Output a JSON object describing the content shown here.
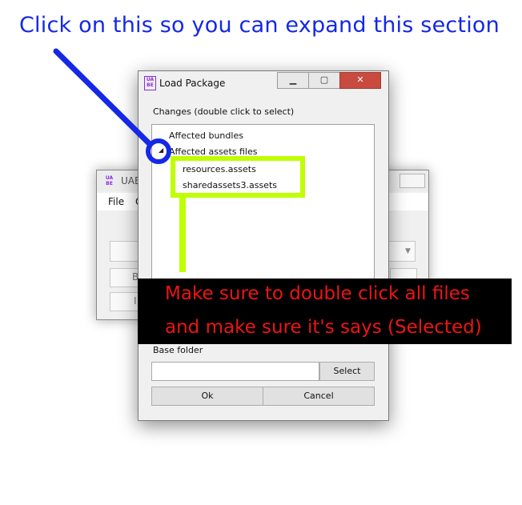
{
  "annotations": {
    "top_text": "Click on this so you can expand this section",
    "callout_line1": "Make sure to double click all files",
    "callout_line2": "and make sure it's says (Selected)",
    "colors": {
      "blue": "#1428e6",
      "green": "#bfff00",
      "red": "#ee1414",
      "callout_bg": "#000000"
    }
  },
  "background_window": {
    "logo": "UA BE",
    "title": "UABE",
    "menu": {
      "file": "File",
      "second": "O"
    },
    "buttons": {
      "btn1": "B",
      "btn2": "I"
    },
    "icons": {
      "combo_arrow": "chevron-down-icon"
    }
  },
  "dialog": {
    "logo": "UA BE",
    "title": "Load Package",
    "caption_buttons": {
      "minimize": "▁",
      "maximize": "▢",
      "close": "✕"
    },
    "changes_label": "Changes (double click to select)",
    "tree": {
      "bundles": "Affected bundles",
      "expander": "◢",
      "assets": "Affected assets files",
      "children": [
        "resources.assets",
        "sharedassets3.assets"
      ]
    },
    "base_folder_label": "Base folder",
    "base_folder_value": "",
    "select_label": "Select",
    "ok_label": "Ok",
    "cancel_label": "Cancel"
  }
}
